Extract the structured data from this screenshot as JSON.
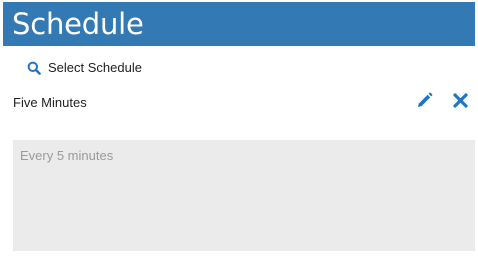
{
  "header": {
    "title": "Schedule",
    "background_color": "#3379b3"
  },
  "select_schedule": {
    "icon": "search-icon",
    "label": "Select Schedule"
  },
  "selected": {
    "name": "Five Minutes",
    "edit_icon": "pencil-icon",
    "remove_icon": "close-icon",
    "accent_color": "#1f75c2"
  },
  "description": {
    "text": "Every 5 minutes"
  }
}
